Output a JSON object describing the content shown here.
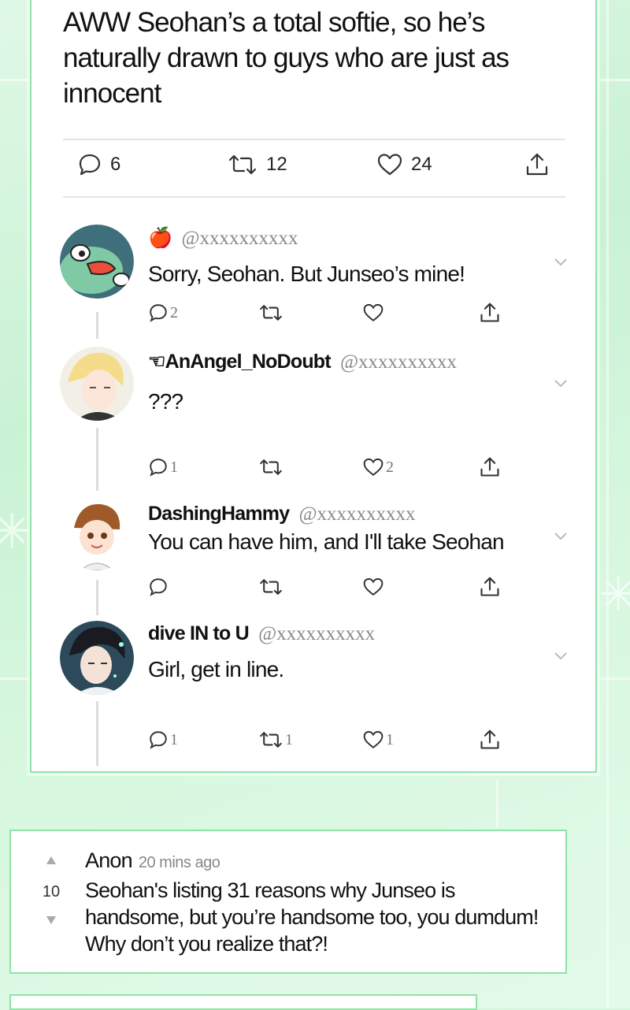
{
  "post": {
    "text": "AWW Seohan’s a total softie, so he’s naturally drawn to guys who are just as innocent",
    "reply_count": "6",
    "retweet_count": "12",
    "like_count": "24"
  },
  "replies": [
    {
      "emoji": "🍎",
      "display_name": "",
      "handle": "@xxxxxxxxxx",
      "text": "Sorry, Seohan. But Junseo’s mine!",
      "replies": "2",
      "retweets": "",
      "likes": ""
    },
    {
      "emoji": "",
      "display_name": "☜AnAngel_NoDoubt",
      "handle": "@xxxxxxxxxx",
      "text": "???",
      "replies": "1",
      "retweets": "",
      "likes": "2"
    },
    {
      "emoji": "",
      "display_name": "DashingHammy",
      "handle": "@xxxxxxxxxx",
      "text": "You can have him, and I'll take Seohan",
      "replies": "",
      "retweets": "",
      "likes": ""
    },
    {
      "emoji": "",
      "display_name": "dive IN to U",
      "handle": "@xxxxxxxxxx",
      "text": "Girl, get in line.",
      "replies": "1",
      "retweets": "1",
      "likes": "1"
    }
  ],
  "comment": {
    "author": "Anon",
    "time": "20 mins ago",
    "score": "10",
    "text": "Seohan's listing 31 reasons why Junseo is handsome, but you’re handsome too, you dumdum! Why don’t you realize that?!"
  },
  "icons": {
    "reply": "speech-bubble-icon",
    "retweet": "retweet-icon",
    "like": "heart-icon",
    "share": "share-icon",
    "menu": "chevron-down-icon",
    "upvote": "triangle-up-icon",
    "downvote": "triangle-down-icon"
  },
  "colors": {
    "border": "#8fe3a8",
    "background": "#d6f7de"
  }
}
